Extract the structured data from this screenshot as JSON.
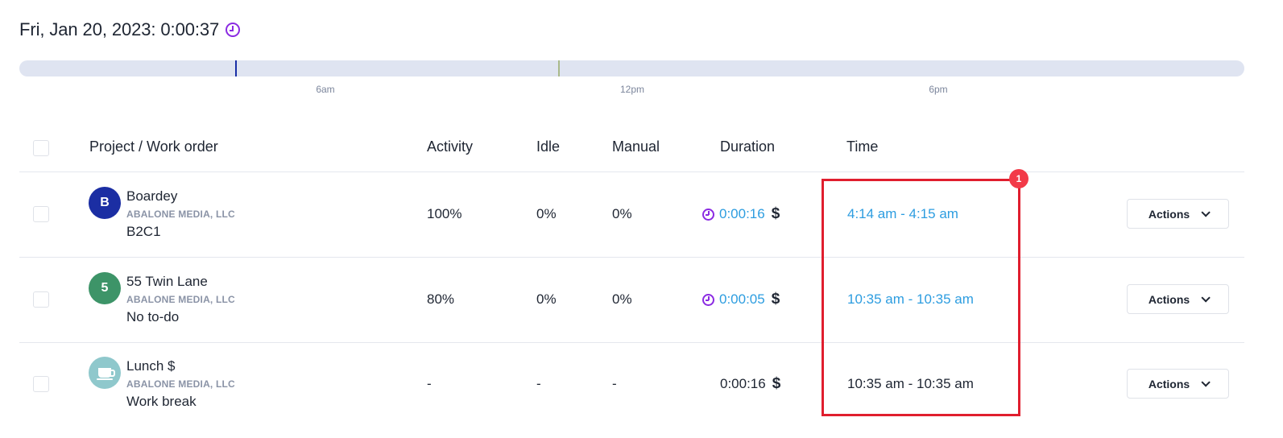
{
  "header": {
    "date_label": "Fri, Jan 20, 2023: 0:00:37"
  },
  "timeline": {
    "ticks": [
      "6am",
      "12pm",
      "6pm"
    ],
    "marker_colors": [
      "#1a2fa6",
      "#a9b98a"
    ]
  },
  "table": {
    "columns": {
      "project": "Project / Work order",
      "activity": "Activity",
      "idle": "Idle",
      "manual": "Manual",
      "duration": "Duration",
      "time": "Time"
    },
    "rows": [
      {
        "avatar_letter": "B",
        "avatar_color": "#1b2ea3",
        "project": "Boardey",
        "client": "ABALONE MEDIA, LLC",
        "todo": "B2C1",
        "activity": "100%",
        "idle": "0%",
        "manual": "0%",
        "duration": "0:00:16",
        "currency": "$",
        "time": "4:14 am - 4:15 am",
        "actions_label": "Actions"
      },
      {
        "avatar_letter": "5",
        "avatar_color": "#3d9468",
        "project": "55 Twin Lane",
        "client": "ABALONE MEDIA, LLC",
        "todo": "No to-do",
        "activity": "80%",
        "idle": "0%",
        "manual": "0%",
        "duration": "0:00:05",
        "currency": "$",
        "time": "10:35 am - 10:35 am",
        "actions_label": "Actions"
      },
      {
        "avatar_icon": "coffee-cup-icon",
        "avatar_color": "#8fc8cc",
        "project": "Lunch $",
        "client": "ABALONE MEDIA, LLC",
        "todo": "Work break",
        "activity": "-",
        "idle": "-",
        "manual": "-",
        "duration": "0:00:16",
        "currency": "$",
        "time": "10:35 am - 10:35 am",
        "actions_label": "Actions"
      }
    ]
  },
  "annotation": {
    "badge": "1",
    "color": "#e01e2e"
  },
  "colors": {
    "accent_purple": "#8b2be2",
    "link_blue": "#2d9de0"
  }
}
